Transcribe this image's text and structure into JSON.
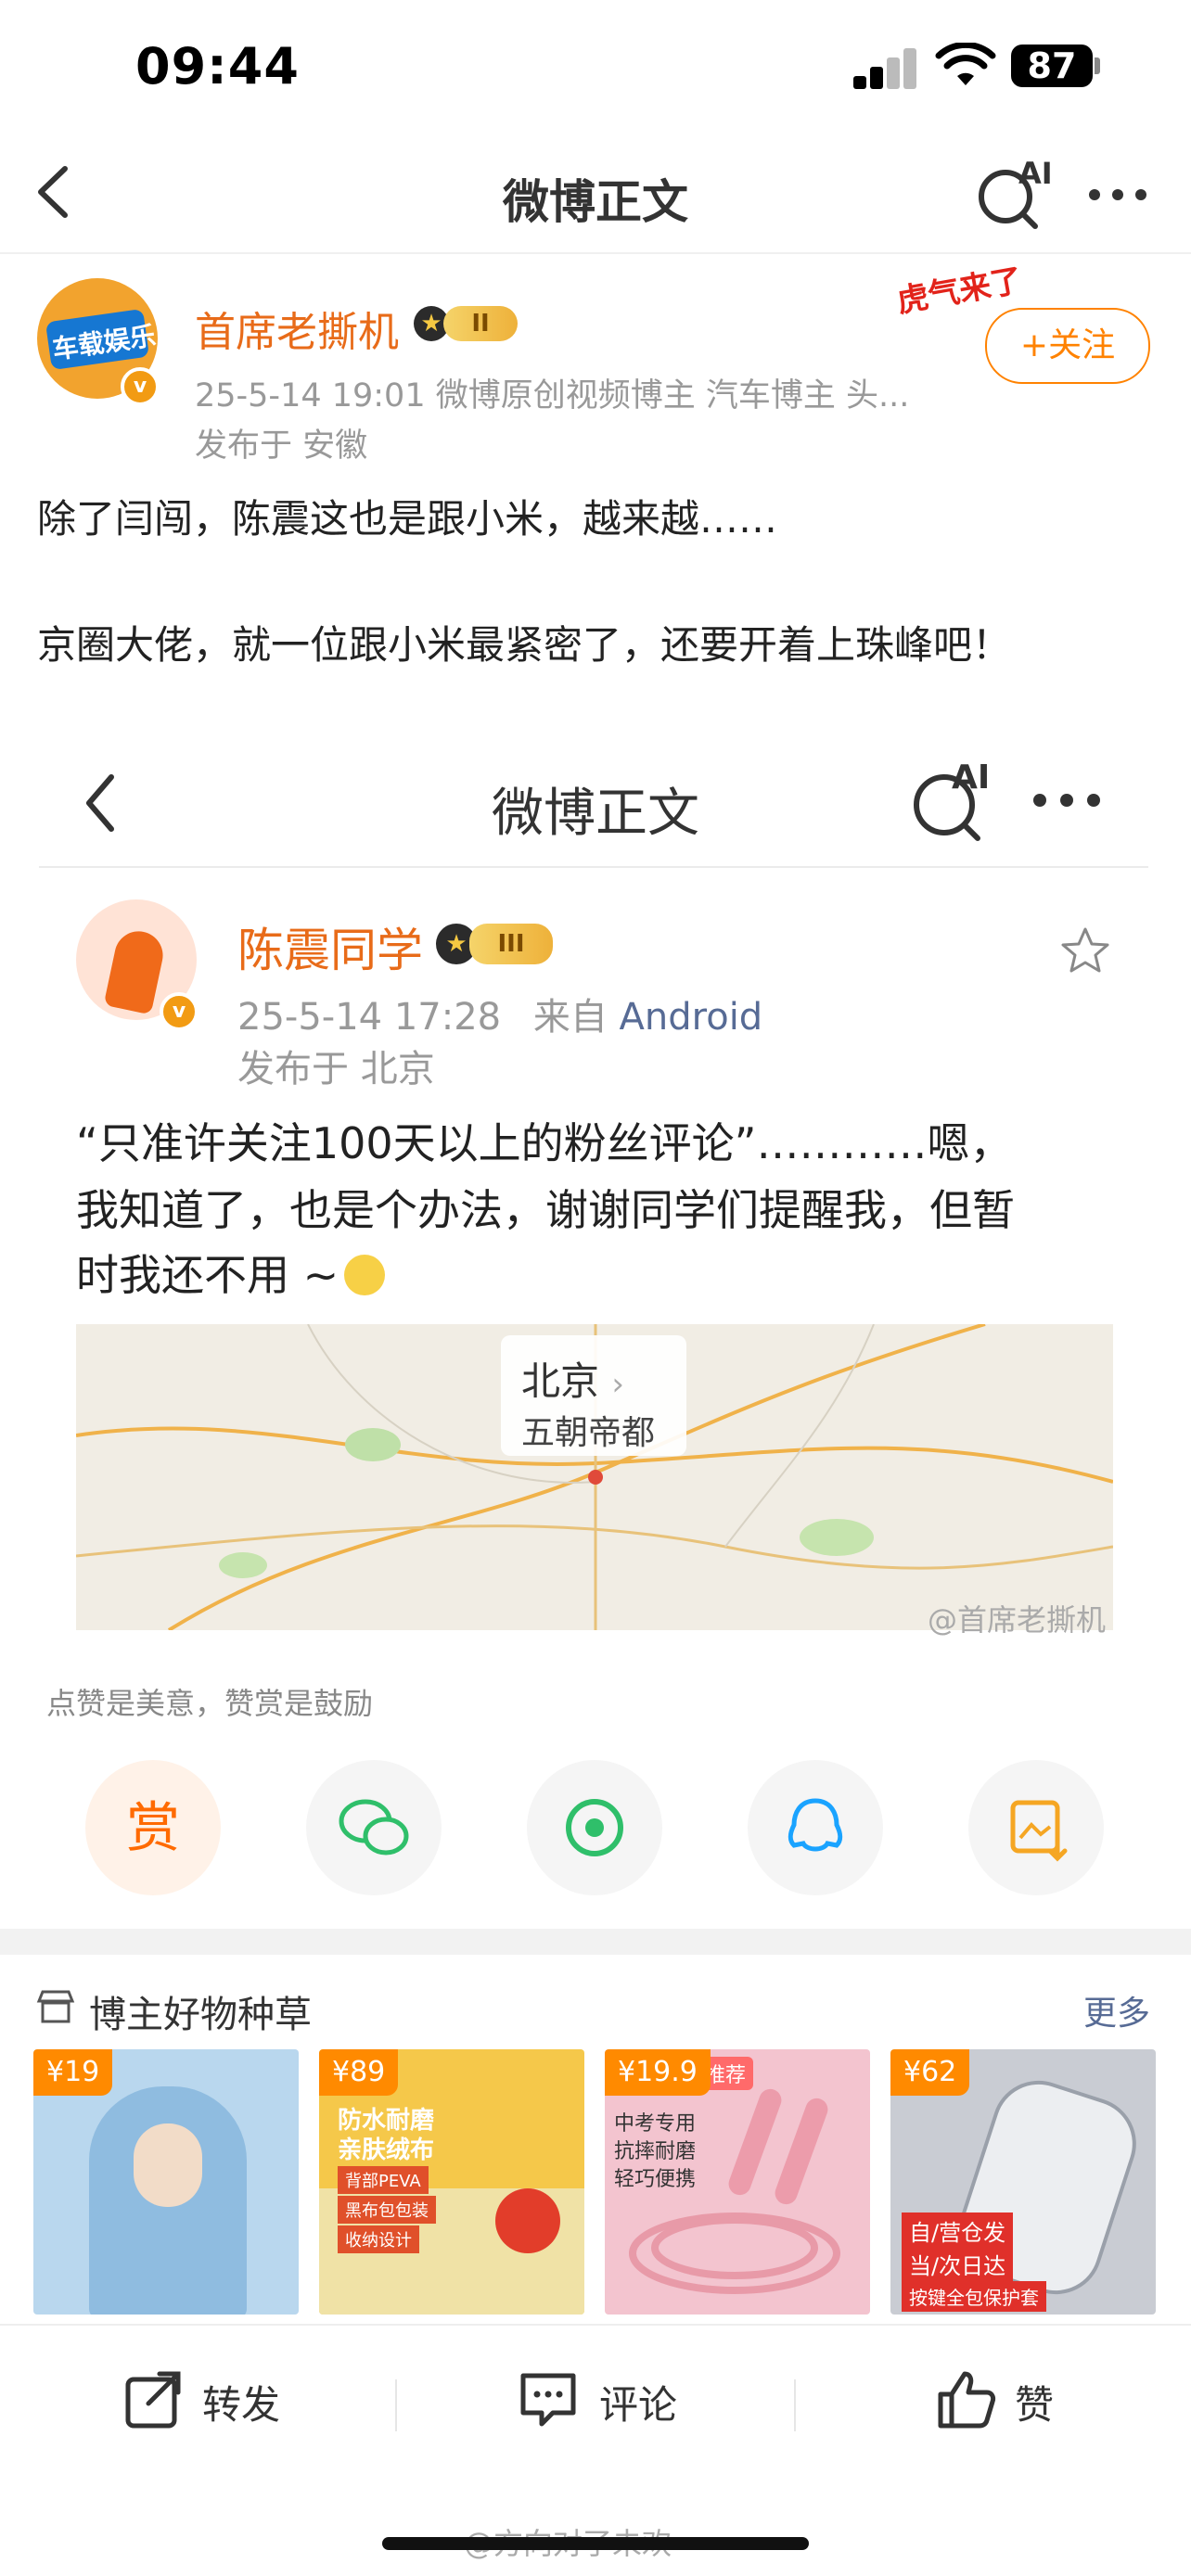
{
  "status_bar": {
    "time": "09:44",
    "battery": "87"
  },
  "nav": {
    "title": "微博正文",
    "ai_label": "AI"
  },
  "post": {
    "author": "首席老撕机",
    "level": "II",
    "meta": "25-5-14 19:01  微博原创视频博主 汽车博主 头...",
    "location": "发布于 安徽",
    "follow_label": "+关注",
    "avatar_text": "车载娱乐",
    "decor_text": "虎气来了",
    "text_line1": "除了闫闯，陈震这也是跟小米，越来越……",
    "text_line2": "京圈大佬，就一位跟小米最紧密了，还要开着上珠峰吧！"
  },
  "embedded": {
    "nav_title": "微博正文",
    "ai_label": "AI",
    "author": "陈震同学",
    "level": "III",
    "time": "25-5-14 17:28",
    "from_label": "来自",
    "source": "Android",
    "location": "发布于 北京",
    "text_line1": "“只准许关注100天以上的粉丝评论”…………嗯，",
    "text_line2": "我知道了，也是个办法，谢谢同学们提醒我，但暂",
    "text_line3": "时我还不用 ~",
    "map_city": "北京",
    "map_sub": "五朝帝都",
    "watermark": "@首席老撕机"
  },
  "reward": {
    "tip": "点赞是美意，赞赏是鼓励",
    "reward_label": "赏"
  },
  "goods": {
    "title": "博主好物种草",
    "more": "更多",
    "items": [
      {
        "price": "¥19",
        "color": "#b9d7ee"
      },
      {
        "price": "¥89",
        "color": "#f5c84a",
        "text1": "防水耐磨",
        "text2": "亲肤绒布",
        "text3": "背部PEVA",
        "text4": "黑布包包装",
        "text5": "收纳设计"
      },
      {
        "price": "¥19.9",
        "color": "#f3c4cf",
        "badge": "推荐",
        "text1": "中考专用",
        "text2": "抗摔耐磨",
        "text3": "轻巧便携"
      },
      {
        "price": "¥62",
        "color": "#c9ccd3",
        "text1": "自/营仓发",
        "text2": "当/次日达",
        "text3": "按键全包保护套"
      }
    ]
  },
  "actions": {
    "repost": "转发",
    "comment": "评论",
    "like": "赞"
  },
  "home_watermark": "@方向对了未欢"
}
